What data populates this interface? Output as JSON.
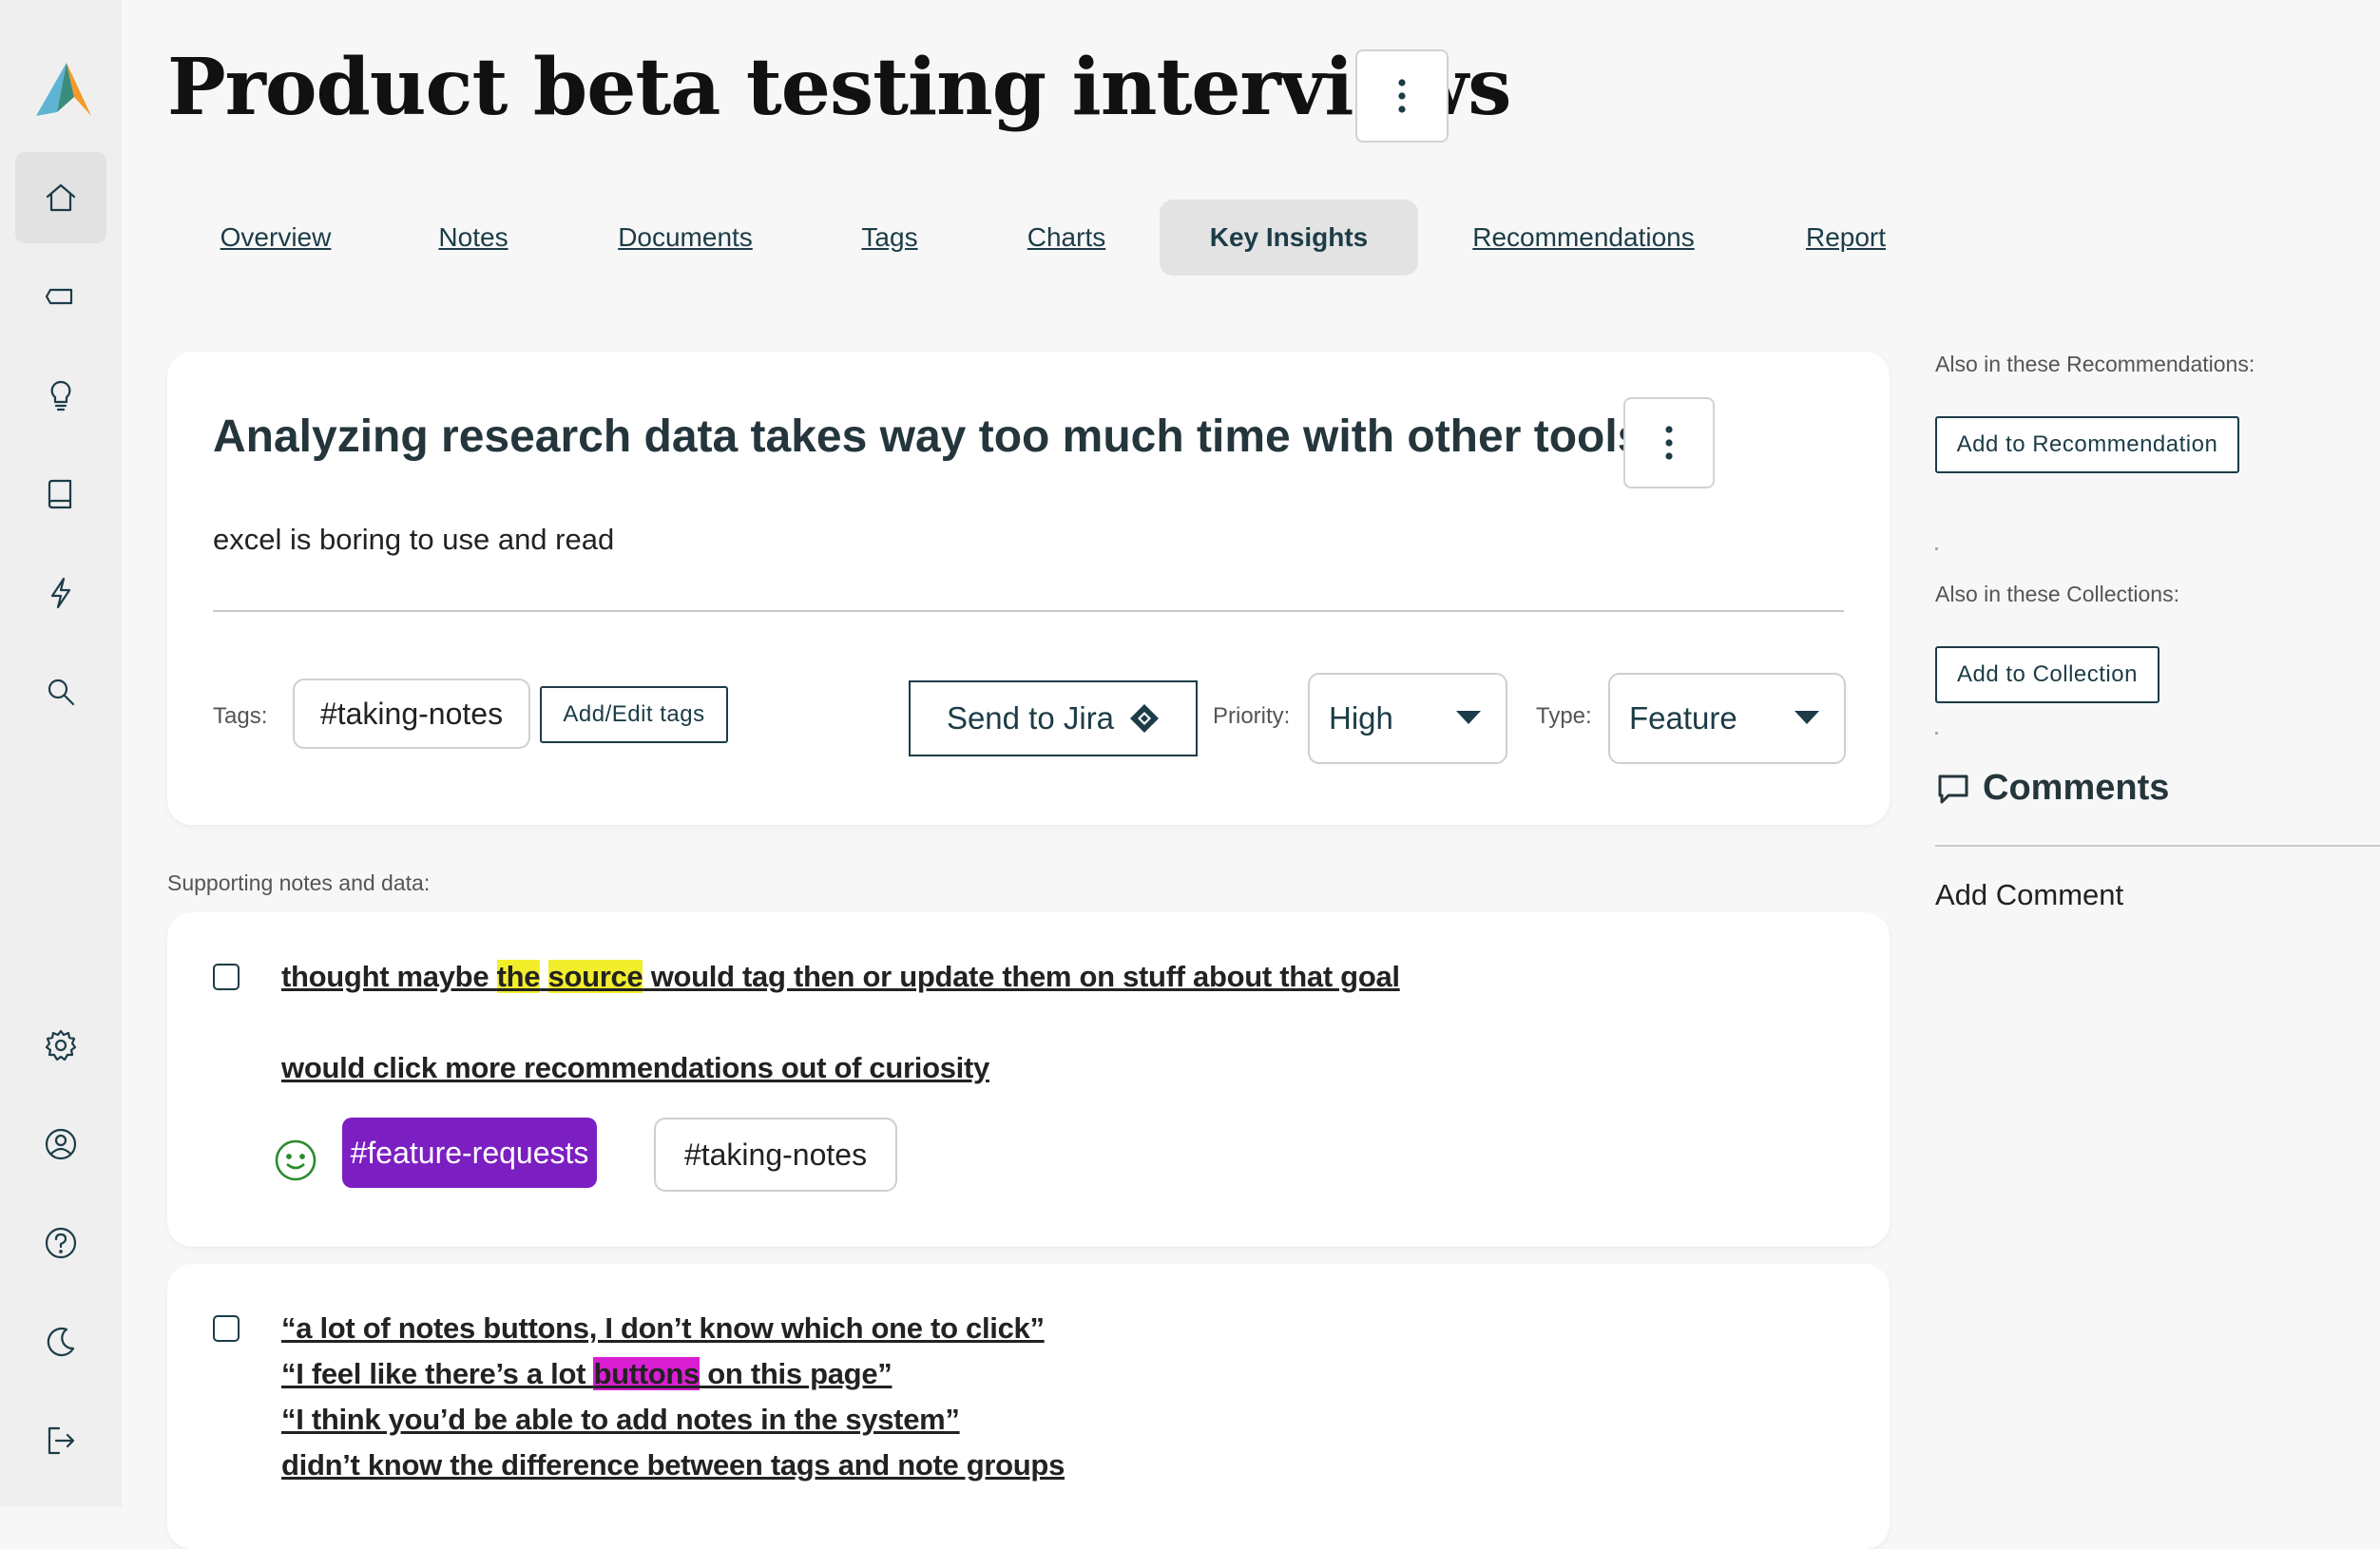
{
  "page": {
    "title": "Product beta testing interviews"
  },
  "tabs": [
    {
      "label": "Overview",
      "active": false
    },
    {
      "label": "Notes",
      "active": false
    },
    {
      "label": "Documents",
      "active": false
    },
    {
      "label": "Tags",
      "active": false
    },
    {
      "label": "Charts",
      "active": false
    },
    {
      "label": "Key Insights",
      "active": true
    },
    {
      "label": "Recommendations",
      "active": false
    },
    {
      "label": "Report",
      "active": false
    }
  ],
  "sidebar": {
    "top_icons": [
      "home-icon",
      "tag-icon",
      "lightbulb-icon",
      "book-icon",
      "lightning-icon",
      "search-icon"
    ],
    "bottom_icons": [
      "settings-icon",
      "user-account-icon",
      "help-icon",
      "dark-mode-icon",
      "logout-icon"
    ],
    "active": "home-icon"
  },
  "insight": {
    "title": "Analyzing research data takes way too much time with other tools",
    "description": "excel is boring to use and read",
    "tags_label": "Tags:",
    "tags": [
      "#taking-notes"
    ],
    "add_edit_tags": "Add/Edit tags",
    "send_to_jira": "Send to Jira",
    "priority_label": "Priority:",
    "priority_value": "High",
    "type_label": "Type:",
    "type_value": "Feature"
  },
  "right_panel": {
    "recommendations_label": "Also in these Recommendations:",
    "add_to_recommendation": "Add to Recommendation",
    "collections_label": "Also in these Collections:",
    "add_to_collection": "Add to Collection",
    "comments_title": "Comments",
    "add_comment": "Add Comment"
  },
  "supporting": {
    "label": "Supporting notes and data:",
    "notes": [
      {
        "line1_pre": "thought maybe ",
        "line1_hl1": "the",
        "line1_mid": " ",
        "line1_hl2": "source",
        "line1_post": " would tag then or update them on stuff about that goal",
        "line2": "would click more recommendations out of curiosity",
        "tags": [
          "#feature-requests",
          "#taking-notes"
        ]
      },
      {
        "line1": "“a lot of notes buttons, I don’t know which one to click”",
        "line2_pre": "“I feel like there’s a lot ",
        "line2_hl": "buttons",
        "line2_post": " on this page”",
        "line3": "“I think you’d be able to add notes in the system”",
        "line4": "didn’t know the difference between tags and note groups"
      }
    ]
  },
  "colors": {
    "accent": "#1c3c47",
    "highlight_yellow": "#f3ee2c",
    "highlight_magenta": "#d91fd1",
    "tag_purple": "#7c1fc2",
    "sentiment_green": "#2a8a2a"
  }
}
